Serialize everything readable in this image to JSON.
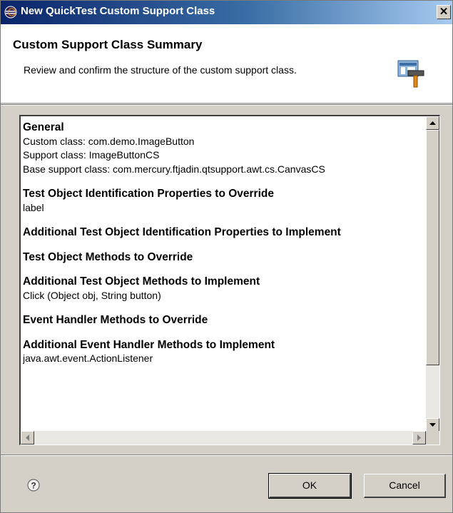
{
  "window": {
    "title": "New QuickTest Custom Support Class",
    "close_label": "✕"
  },
  "header": {
    "title": "Custom Support Class Summary",
    "description": "Review and confirm the structure of the custom support class."
  },
  "summary": {
    "general_heading": "General",
    "custom_class": "Custom class: com.demo.ImageButton",
    "support_class": "Support class: ImageButtonCS",
    "base_support_class": "Base support class: com.mercury.ftjadin.qtsupport.awt.cs.CanvasCS",
    "to_override_props_heading": "Test Object Identification Properties to Override",
    "to_override_props_value": "label",
    "additional_props_heading": "Additional  Test Object Identification Properties to Implement",
    "to_override_methods_heading": "Test Object Methods to Override",
    "additional_methods_heading": "Additional  Test Object Methods to Implement",
    "additional_methods_value": "Click (Object obj, String button)",
    "event_override_heading": "Event Handler Methods to Override",
    "additional_event_heading": "Additional  Event Handler Methods to Implement",
    "additional_event_value": "java.awt.event.ActionListener"
  },
  "buttons": {
    "ok": "OK",
    "cancel": "Cancel"
  },
  "colors": {
    "titlebar_start": "#0a246a",
    "titlebar_end": "#a6caf0",
    "dialog_bg": "#d4d0c8"
  }
}
